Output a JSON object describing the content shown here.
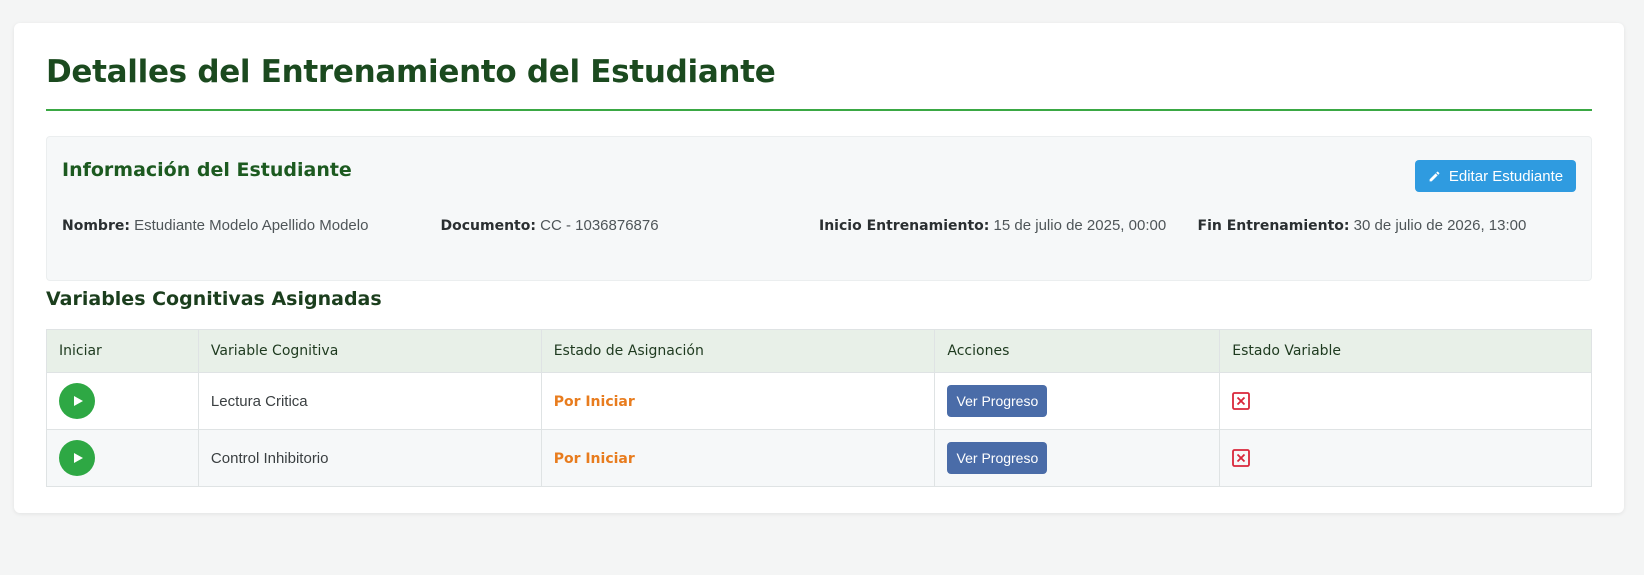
{
  "page": {
    "title": "Detalles del Entrenamiento del Estudiante"
  },
  "student_info": {
    "heading": "Información del Estudiante",
    "edit_button_label": "Editar Estudiante",
    "edit_icon": "pencil-icon",
    "fields": [
      {
        "label": "Nombre:",
        "value": "Estudiante Modelo Apellido Modelo"
      },
      {
        "label": "Documento:",
        "value": "CC - 1036876876"
      },
      {
        "label": "Inicio Entrenamiento:",
        "value": "15 de julio de 2025, 00:00"
      },
      {
        "label": "Fin Entrenamiento:",
        "value": "30 de julio de 2026, 13:00"
      }
    ]
  },
  "variables": {
    "title": "Variables Cognitivas Asignadas",
    "columns": [
      "Iniciar",
      "Variable Cognitiva",
      "Estado de Asignación",
      "Acciones",
      "Estado Variable"
    ],
    "rows": [
      {
        "play_icon": "play-icon",
        "variable": "Lectura Critica",
        "status": "Por Iniciar",
        "action_label": "Ver Progreso",
        "state_icon": "x-square-icon"
      },
      {
        "play_icon": "play-icon",
        "variable": "Control Inhibitorio",
        "status": "Por Iniciar",
        "action_label": "Ver Progreso",
        "state_icon": "x-square-icon"
      }
    ]
  },
  "colors": {
    "title": "#1b4a1f",
    "accent_rule": "#3aa844",
    "edit_button": "#2f9be0",
    "play_button": "#2ea844",
    "status_pending": "#e87c1e",
    "progress_button": "#4a6ca8",
    "state_icon": "#d9263a"
  }
}
